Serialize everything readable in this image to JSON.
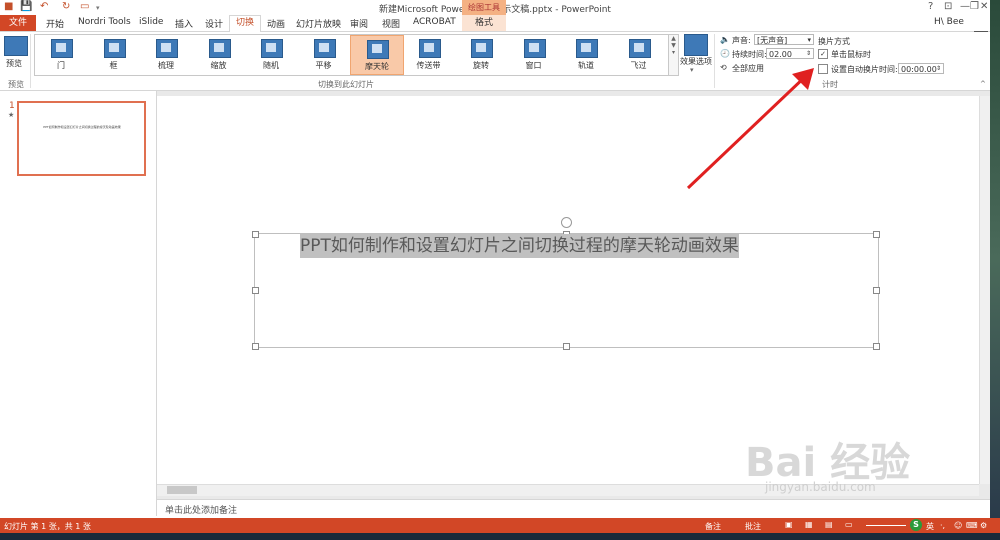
{
  "titlebar": {
    "title": "新建Microsoft PowerPoint 演示文稿.pptx - PowerPoint",
    "drawing_tools": "绘图工具",
    "window_buttons": [
      "?",
      "⊡",
      "—",
      "❐",
      "✕"
    ]
  },
  "tabs": {
    "file": "文件",
    "items": [
      "开始",
      "Nordri Tools",
      "iSlide",
      "插入",
      "设计"
    ],
    "active": "切换",
    "after": [
      "动画",
      "幻灯片放映",
      "审阅",
      "视图",
      "ACROBAT"
    ],
    "format": "格式",
    "user": "H\\ Bee"
  },
  "ribbon": {
    "preview_label": "预览",
    "preview_group": "预览",
    "transitions": [
      "门",
      "框",
      "梳理",
      "缩放",
      "随机",
      "平移",
      "摩天轮",
      "传送带",
      "旋转",
      "窗口",
      "轨道",
      "飞过"
    ],
    "selected_transition": "摩天轮",
    "group_label": "切换到此幻灯片",
    "effect_options": "效果选项",
    "sound_label": "声音:",
    "sound_value": "[无声音]",
    "duration_label": "持续时间:",
    "duration_value": "02.00",
    "apply_all": "全部应用",
    "advance_heading": "换片方式",
    "on_click": "单击鼠标时",
    "after_time": "设置自动换片时间:",
    "after_time_value": "00:00.00",
    "timing_group": "计时"
  },
  "slides": {
    "number": "1",
    "thumb_text": "PPT如何制作和设置幻灯片之间切换过程的摩天轮动画效果"
  },
  "slide": {
    "title": "PPT如何制作和设置幻灯片之间切换过程的摩天轮动画效果"
  },
  "notes": {
    "placeholder": "单击此处添加备注"
  },
  "status": {
    "slide_info": "幻灯片 第 1 张，共 1 张",
    "notes_btn": "备注",
    "comments_btn": "批注"
  },
  "watermark": {
    "main": "Bai 经验",
    "url": "jingyan.baidu.com"
  },
  "colors": {
    "accent": "#d24726",
    "selected": "#f9c9a8",
    "arrow": "#e02020"
  }
}
